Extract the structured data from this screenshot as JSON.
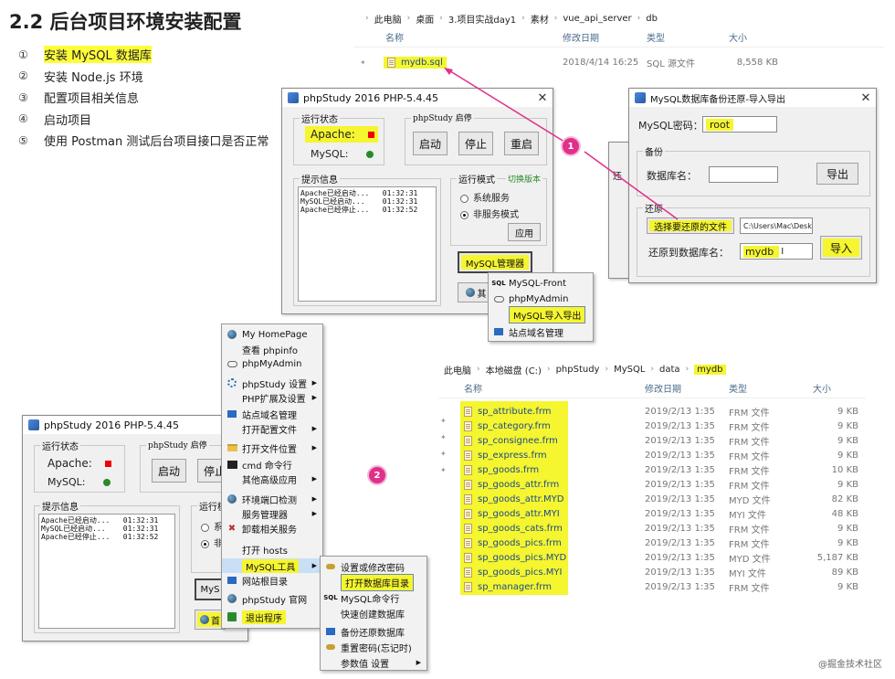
{
  "slide": {
    "title": "2.2 后台项目环境安装配置",
    "steps": [
      {
        "num": "①",
        "text": "安装 MySQL 数据库",
        "highlight": true
      },
      {
        "num": "②",
        "text": "安装 Node.js 环境",
        "highlight": false
      },
      {
        "num": "③",
        "text": "配置项目相关信息",
        "highlight": false
      },
      {
        "num": "④",
        "text": "启动项目",
        "highlight": false
      },
      {
        "num": "⑤",
        "text": "使用 Postman 测试后台项目接口是否正常",
        "highlight": false
      }
    ],
    "watermark": "@掘金技术社区"
  },
  "explorer_top": {
    "crumbs": [
      "此电脑",
      "桌面",
      "3.项目实战day1",
      "素材",
      "vue_api_server",
      "db"
    ],
    "cols": [
      "名称",
      "修改日期",
      "类型",
      "大小"
    ],
    "row": {
      "name": "mydb.sql",
      "date": "2018/4/14 16:25",
      "type": "SQL 源文件",
      "size": "8,558 KB"
    }
  },
  "explorer_bottom": {
    "crumbs": [
      "此电脑",
      "本地磁盘 (C:)",
      "phpStudy",
      "MySQL",
      "data",
      "mydb"
    ],
    "cols": [
      "名称",
      "修改日期",
      "类型",
      "大小"
    ],
    "files": [
      {
        "name": "sp_attribute.frm",
        "date": "2019/2/13 1:35",
        "type": "FRM 文件",
        "size": "9 KB"
      },
      {
        "name": "sp_category.frm",
        "date": "2019/2/13 1:35",
        "type": "FRM 文件",
        "size": "9 KB"
      },
      {
        "name": "sp_consignee.frm",
        "date": "2019/2/13 1:35",
        "type": "FRM 文件",
        "size": "9 KB"
      },
      {
        "name": "sp_express.frm",
        "date": "2019/2/13 1:35",
        "type": "FRM 文件",
        "size": "9 KB"
      },
      {
        "name": "sp_goods.frm",
        "date": "2019/2/13 1:35",
        "type": "FRM 文件",
        "size": "10 KB"
      },
      {
        "name": "sp_goods_attr.frm",
        "date": "2019/2/13 1:35",
        "type": "FRM 文件",
        "size": "9 KB"
      },
      {
        "name": "sp_goods_attr.MYD",
        "date": "2019/2/13 1:35",
        "type": "MYD 文件",
        "size": "82 KB"
      },
      {
        "name": "sp_goods_attr.MYI",
        "date": "2019/2/13 1:35",
        "type": "MYI 文件",
        "size": "48 KB"
      },
      {
        "name": "sp_goods_cats.frm",
        "date": "2019/2/13 1:35",
        "type": "FRM 文件",
        "size": "9 KB"
      },
      {
        "name": "sp_goods_pics.frm",
        "date": "2019/2/13 1:35",
        "type": "FRM 文件",
        "size": "9 KB"
      },
      {
        "name": "sp_goods_pics.MYD",
        "date": "2019/2/13 1:35",
        "type": "MYD 文件",
        "size": "5,187 KB"
      },
      {
        "name": "sp_goods_pics.MYI",
        "date": "2019/2/13 1:35",
        "type": "MYI 文件",
        "size": "89 KB"
      },
      {
        "name": "sp_manager.frm",
        "date": "2019/2/13 1:35",
        "type": "FRM 文件",
        "size": "9 KB"
      }
    ]
  },
  "phpstudy1": {
    "title": "phpStudy 2016   PHP-5.4.45",
    "status_label": "运行状态",
    "apache": "Apache:",
    "mysql": "MySQL:",
    "control_label": "phpStudy 启停",
    "start": "启动",
    "stop": "停止",
    "restart": "重启",
    "log_label": "提示信息",
    "log": "Apache已经启动...   01:32:31\nMySQL已经启动...    01:32:31\nApache已经停止...   01:32:52",
    "mode_label": "运行模式",
    "switch_version": "切换版本",
    "mode_system": "系统服务",
    "mode_nonservice": "非服务模式",
    "apply": "应用",
    "mysql_manager": "MySQL管理器",
    "other": "其"
  },
  "mysql_submenu": {
    "items": [
      {
        "icon": "SQL",
        "label": "MySQL-Front"
      },
      {
        "icon": "ring",
        "label": "phpMyAdmin"
      },
      {
        "icon": "",
        "label": "MySQL导入导出"
      },
      {
        "icon": "site",
        "label": "站点域名管理"
      }
    ]
  },
  "backup_dialog": {
    "title": "MySQL数据库备份还原-导入导出",
    "pwd_label": "MySQL密码：",
    "pwd_value": "root",
    "backup_label": "备份",
    "dbname_label": "数据库名：",
    "export": "导出",
    "restore_label": "还原",
    "choose_file": "选择要还原的文件",
    "file_path": "C:\\Users\\Mac\\Deskt",
    "restore_to": "还原到数据库名：",
    "restore_db": "mydb",
    "import": "导入"
  },
  "behind_dialog": {
    "label": "还"
  },
  "phpstudy2": {
    "title": "phpStudy 2016   PHP-5.4.45",
    "status_label": "运行状态",
    "apache": "Apache:",
    "mysql": "MySQL:",
    "control_label": "phpStudy 启停",
    "start": "启动",
    "stop": "停止",
    "log_label": "提示信息",
    "log": "Apache已经启动...   01:32:31\nMySQL已经启动...    01:32:31\nApache已经停止...   01:32:52",
    "mode_label": "运行模",
    "mode_sys": "系",
    "mode_non": "非",
    "mysql_btn": "MyS",
    "other": "首"
  },
  "tray_menu": {
    "items": [
      {
        "icon": "globe",
        "label": "My HomePage",
        "arrow": false
      },
      {
        "icon": "",
        "label": "查看 phpinfo",
        "arrow": false
      },
      {
        "icon": "ring",
        "label": "phpMyAdmin",
        "arrow": false
      },
      {
        "icon": "gear",
        "label": "phpStudy 设置",
        "arrow": true
      },
      {
        "icon": "",
        "label": "PHP扩展及设置",
        "arrow": true
      },
      {
        "icon": "site",
        "label": "站点域名管理",
        "arrow": false
      },
      {
        "icon": "",
        "label": "打开配置文件",
        "arrow": true
      },
      {
        "icon": "folder",
        "label": "打开文件位置",
        "arrow": true
      },
      {
        "icon": "cmd",
        "label": "cmd 命令行",
        "arrow": false
      },
      {
        "icon": "",
        "label": "其他高级应用",
        "arrow": true
      },
      {
        "icon": "dot",
        "label": "环境端口检测",
        "arrow": true
      },
      {
        "icon": "",
        "label": "服务管理器",
        "arrow": true
      },
      {
        "icon": "x",
        "label": "卸载相关服务",
        "arrow": false
      },
      {
        "icon": "",
        "label": "打开 hosts",
        "arrow": false
      },
      {
        "icon": "",
        "label": "MySQL工具",
        "arrow": true
      },
      {
        "icon": "site",
        "label": "网站根目录",
        "arrow": false
      },
      {
        "icon": "globe",
        "label": "phpStudy 官网",
        "arrow": false
      },
      {
        "icon": "exit",
        "label": "退出程序",
        "arrow": false
      }
    ]
  },
  "mysql_tools_menu": {
    "items": [
      {
        "icon": "key",
        "label": "设置或修改密码",
        "arrow": false
      },
      {
        "icon": "",
        "label": "打开数据库目录",
        "arrow": false
      },
      {
        "icon": "SQL",
        "label": "MySQL命令行",
        "arrow": false
      },
      {
        "icon": "",
        "label": "快速创建数据库",
        "arrow": false
      },
      {
        "icon": "db",
        "label": "备份还原数据库",
        "arrow": false
      },
      {
        "icon": "key",
        "label": "重置密码(忘记时)",
        "arrow": false
      },
      {
        "icon": "",
        "label": "参数值 设置",
        "arrow": true
      }
    ]
  },
  "callouts": [
    "1",
    "2"
  ],
  "colors": {
    "highlight": "#fdfd3b",
    "arrow": "#e0308a",
    "selected": "#c9dff5"
  }
}
